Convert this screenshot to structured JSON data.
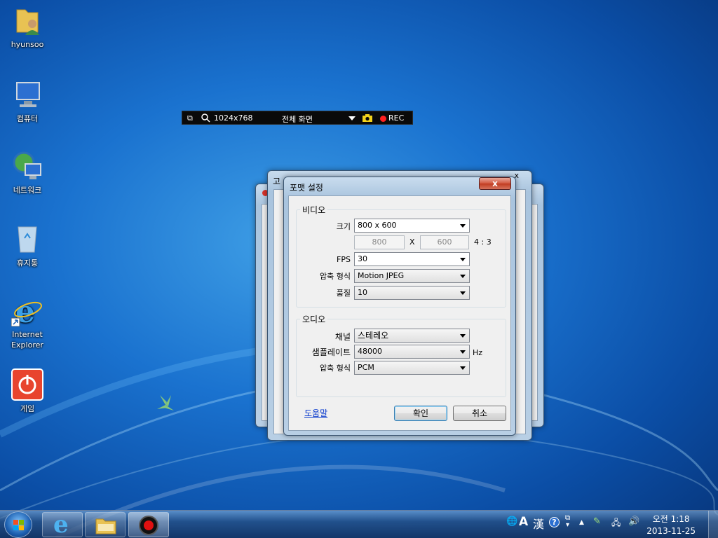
{
  "desktop": {
    "icons": [
      {
        "label": "hyunsoo",
        "icon": "user-folder-icon"
      },
      {
        "label": "컴퓨터",
        "icon": "computer-icon"
      },
      {
        "label": "네트워크",
        "icon": "network-icon"
      },
      {
        "label": "휴지통",
        "icon": "recycle-bin-icon"
      },
      {
        "label": "Internet Explorer",
        "icon": "internet-explorer-icon"
      },
      {
        "label": "게임",
        "icon": "power-game-icon"
      }
    ]
  },
  "recorder_bar": {
    "resolution": "1024x768",
    "mode": "전체 화면",
    "rec_label": "REC",
    "rec_color": "#ff2020"
  },
  "back_window": {
    "title": "고"
  },
  "dialog": {
    "title": "포맷 설정",
    "close_label": "x",
    "video": {
      "group_title": "비디오",
      "size_label": "크기",
      "size_value": "800 x 600",
      "width_value": "800",
      "x_label": "X",
      "height_value": "600",
      "ratio": "4 : 3",
      "fps_label": "FPS",
      "fps_value": "30",
      "codec_label": "압축 형식",
      "codec_value": "Motion JPEG",
      "quality_label": "품질",
      "quality_value": "10"
    },
    "audio": {
      "group_title": "오디오",
      "channel_label": "채널",
      "channel_value": "스테레오",
      "samplerate_label": "샘플레이트",
      "samplerate_value": "48000",
      "hz_label": "Hz",
      "codec_label": "압축 형식",
      "codec_value": "PCM"
    },
    "help_link": "도움말",
    "ok_label": "확인",
    "cancel_label": "취소"
  },
  "taskbar": {
    "clock_time": "오전 1:18",
    "clock_date": "2013-11-25",
    "ime_mode": "A",
    "ime_hanja": "漢",
    "accent": "#1a72cf"
  }
}
